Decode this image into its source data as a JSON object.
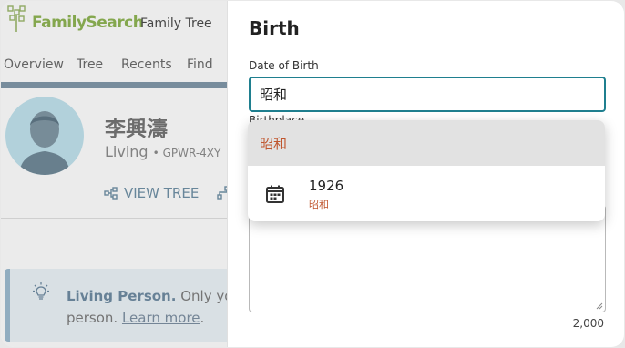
{
  "app": {
    "brand": "FamilySearch",
    "nav_link": "Family Tree"
  },
  "tabs": [
    "Overview",
    "Tree",
    "Recents",
    "Find"
  ],
  "person": {
    "name": "李興濤",
    "status": "Living",
    "id": "GPWR-4XY",
    "view_tree": "VIEW TREE"
  },
  "notice": {
    "bold": "Living Person.",
    "text": "Only you",
    "line2": "person.",
    "link": "Learn more",
    "end": "."
  },
  "panel": {
    "title": "Birth",
    "date_label": "Date of Birth",
    "date_value": "昭和",
    "place_label_partial": "Birthplace",
    "char_count": "2,000"
  },
  "dropdown": {
    "header": "昭和",
    "items": [
      {
        "year": "1926",
        "era": "昭和"
      }
    ]
  },
  "colors": {
    "accent_teal": "#1f7f8f",
    "era_orange": "#c0562e",
    "brand_green": "#8db253"
  }
}
